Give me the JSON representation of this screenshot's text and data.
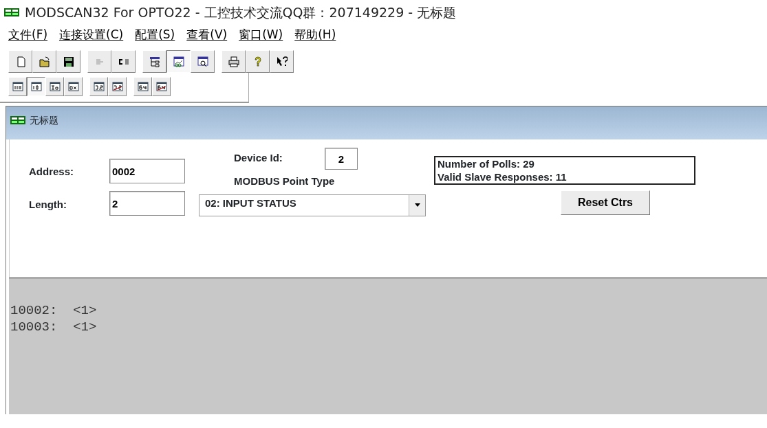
{
  "window": {
    "title": "MODSCAN32 For OPTO22 - 工控技术交流QQ群：207149229 - 无标题"
  },
  "menu": [
    {
      "label": "文件(F)"
    },
    {
      "label": "连接设置(C)"
    },
    {
      "label": "配置(S)"
    },
    {
      "label": "查看(V)"
    },
    {
      "label": "窗口(W)"
    },
    {
      "label": "帮助(H)"
    }
  ],
  "toolbar": [
    [
      {
        "kind": "new",
        "pressed": false,
        "disabled": false
      },
      {
        "kind": "open",
        "pressed": false,
        "disabled": false
      },
      {
        "kind": "save",
        "pressed": false,
        "disabled": false
      }
    ],
    [
      {
        "kind": "connect",
        "pressed": false,
        "disabled": true
      },
      {
        "kind": "disconnect",
        "pressed": false,
        "disabled": false
      }
    ],
    [
      {
        "kind": "tree",
        "pressed": false,
        "disabled": false
      },
      {
        "kind": "display",
        "pressed": true,
        "disabled": false
      },
      {
        "kind": "inspect",
        "pressed": false,
        "disabled": false
      }
    ],
    [
      {
        "kind": "print",
        "pressed": false,
        "disabled": false
      },
      {
        "kind": "help",
        "pressed": false,
        "disabled": false
      },
      {
        "kind": "contexthelp",
        "pressed": false,
        "disabled": false
      }
    ]
  ],
  "format_toolbar": [
    [
      {
        "kind": "binary",
        "selected": false
      },
      {
        "kind": "decimal",
        "selected": true
      },
      {
        "kind": "integer",
        "selected": false
      },
      {
        "kind": "hex",
        "selected": false
      }
    ],
    [
      {
        "kind": "float",
        "selected": false
      },
      {
        "kind": "float-swap",
        "selected": false
      }
    ],
    [
      {
        "kind": "double",
        "selected": false
      },
      {
        "kind": "double-swap",
        "selected": false
      }
    ]
  ],
  "document": {
    "title": "无标题",
    "address": {
      "label": "Address:",
      "value": "0002"
    },
    "length": {
      "label": "Length:",
      "value": "2"
    },
    "device_id": {
      "label": "Device Id:",
      "value": "2"
    },
    "point_type": {
      "label": "MODBUS Point Type",
      "value": "02: INPUT STATUS"
    },
    "counters": [
      "Number of Polls: 29",
      "Valid Slave Responses: 11"
    ],
    "reset_button": "Reset Ctrs",
    "data_rows": [
      "10002:  <1>",
      "10003:  <1>"
    ]
  }
}
